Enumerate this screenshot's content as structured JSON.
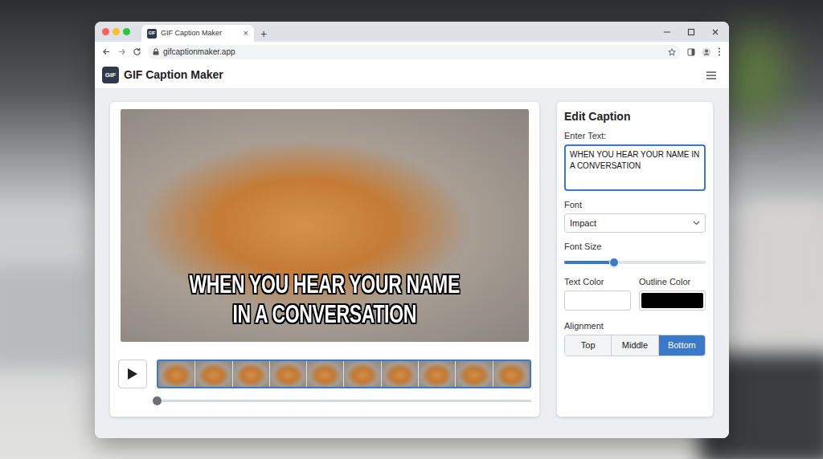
{
  "browser": {
    "tab": {
      "favicon": "GIF",
      "title": "GIF Caption Maker",
      "close": "×"
    },
    "new_tab": "+",
    "address": "gifcaptionmaker.app"
  },
  "app": {
    "logo": "GIF",
    "title": "GIF Caption Maker"
  },
  "preview": {
    "caption_lines": [
      "WHEN YOU HEAR YOUR NAME",
      "IN A CONVERSATION"
    ],
    "playing": false,
    "timeline_level": 0.01
  },
  "editor": {
    "title": "Edit Caption",
    "text_label": "Enter Text:",
    "text_value": "WHEN YOU HEAR YOUR NAME IN A CONVERSATION",
    "font_label": "Font",
    "font_value": "Impact",
    "size_label": "Font Size",
    "size_level": 0.35,
    "text_color_label": "Text Color",
    "text_color": "#ffffff",
    "outline_color_label": "Outline Color",
    "outline_color": "#000000",
    "alignment_label": "Alignment",
    "alignment": [
      {
        "label": "Top",
        "selected": false
      },
      {
        "label": "Middle",
        "selected": false
      },
      {
        "label": "Bottom",
        "selected": true
      }
    ]
  }
}
